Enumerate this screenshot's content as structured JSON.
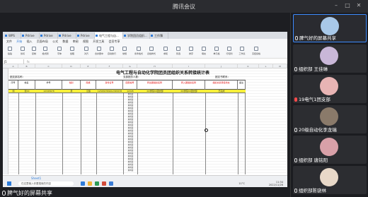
{
  "window": {
    "title": "腾讯会议"
  },
  "tabs": [
    {
      "label": "WPS"
    },
    {
      "label": "Pdrive"
    },
    {
      "label": "Pdrive"
    },
    {
      "label": "Pdrive"
    },
    {
      "label": "Pdrive"
    },
    {
      "label": "电气工程与自..."
    },
    {
      "label": "学院团员组织..."
    },
    {
      "label": "工作簿"
    }
  ],
  "menu": [
    "文件",
    "开始",
    "插入",
    "页面布局",
    "公式",
    "数据",
    "审阅",
    "视图",
    "开发工具",
    "会员专享"
  ],
  "ribbon": [
    "粘贴",
    "剪切",
    "复制",
    "格式刷",
    "字体",
    "加粗",
    "对齐",
    "合并居中",
    "自动换行",
    "常规",
    "条件格式",
    "表格样式",
    "求和",
    "筛选",
    "排序",
    "填充",
    "单元格",
    "行和列",
    "工作表",
    "冻结窗格"
  ],
  "formula": {
    "cell": "J5",
    "fx": "fx"
  },
  "columns": [
    "A",
    "B",
    "C",
    "D",
    "E",
    "F",
    "G",
    "H",
    "I",
    "J",
    "K",
    "L",
    "M"
  ],
  "sheet": {
    "title": "电气工程与自动化学院团员团组织关系转接统计表",
    "meta_left": "团支部名称：",
    "meta_mid": "支部团员人数：",
    "meta_right": "团支书联系：",
    "headers": [
      "序号",
      "姓名",
      "学号",
      "性别",
      "民族",
      "身份证号",
      "团员编号",
      "转出团组织名称",
      "转入团组织名称",
      "组织关系转接状态",
      "备注"
    ],
    "example_row": [
      "例",
      "张XX",
      "12345678",
      "男",
      "汉族",
      "123456789012345678",
      "12345",
      "XX学院XX团支部",
      "XX学院XX团支部",
      "已完成"
    ],
    "fill_word": "未转接",
    "sheet_tab": "Sheet1"
  },
  "taskbar": {
    "search_placeholder": "在这里输入你要搜索的内容",
    "time": "11:34",
    "date": "2022/11/26",
    "weather": "11°C"
  },
  "share_label": "脾气好的屏幕共享",
  "participants": [
    {
      "name": "脾气好的屏幕共享",
      "muted": false,
      "color": "#a8c8e8"
    },
    {
      "name": "组织部 王佳琳",
      "muted": false,
      "color": "#c9b7d8"
    },
    {
      "name": "19电气1团支部",
      "muted": true,
      "color": "#e8b4b4"
    },
    {
      "name": "20级自动化李龙瑞",
      "muted": false,
      "color": "#8a7a6a"
    },
    {
      "name": "组织部 唐铭阳",
      "muted": false,
      "color": "#d8a0a8"
    },
    {
      "name": "组织部陈骁林",
      "muted": false,
      "color": "#e8d8c8"
    }
  ]
}
